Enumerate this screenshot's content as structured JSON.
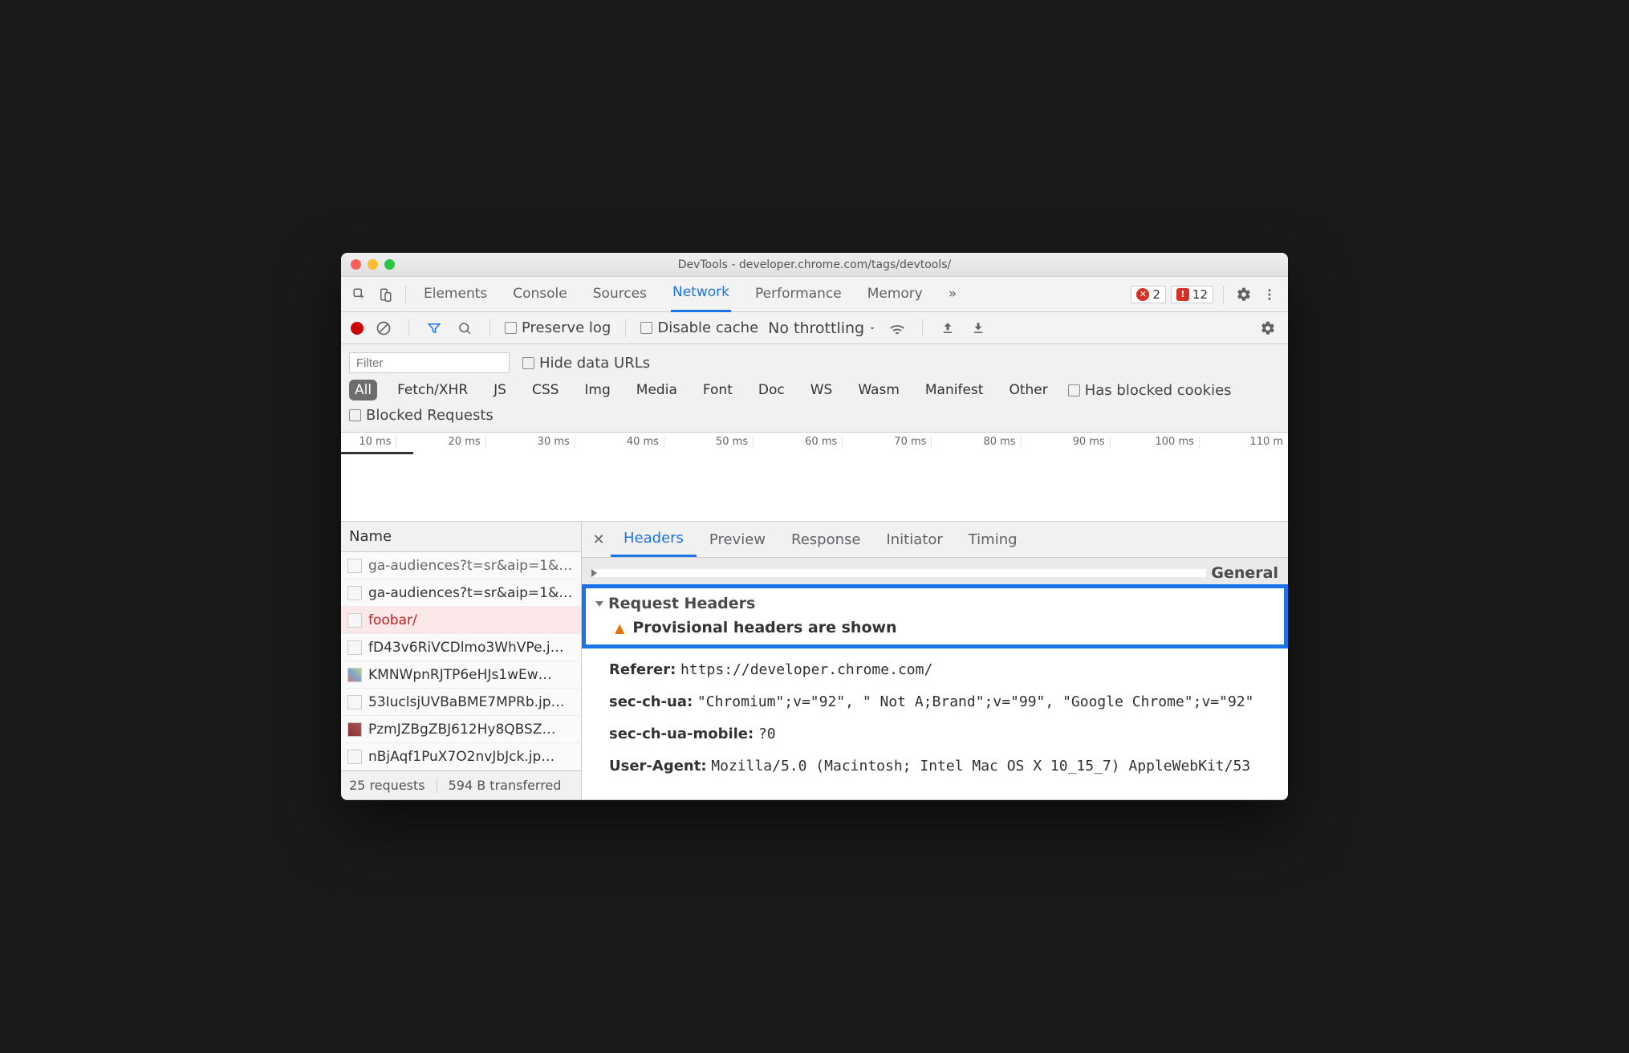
{
  "window": {
    "title": "DevTools - developer.chrome.com/tags/devtools/"
  },
  "tabs": {
    "items": [
      "Elements",
      "Console",
      "Sources",
      "Network",
      "Performance",
      "Memory"
    ],
    "active": "Network",
    "overflow": "»",
    "errors_badge": "2",
    "issues_badge": "12"
  },
  "sub1": {
    "preserve_log": "Preserve log",
    "disable_cache": "Disable cache",
    "throttling": "No throttling"
  },
  "filter": {
    "placeholder": "Filter",
    "hide_data_urls": "Hide data URLs",
    "types": [
      "All",
      "Fetch/XHR",
      "JS",
      "CSS",
      "Img",
      "Media",
      "Font",
      "Doc",
      "WS",
      "Wasm",
      "Manifest",
      "Other"
    ],
    "has_blocked_cookies": "Has blocked cookies",
    "blocked_requests": "Blocked Requests"
  },
  "timeline": {
    "ticks": [
      "10 ms",
      "20 ms",
      "30 ms",
      "40 ms",
      "50 ms",
      "60 ms",
      "70 ms",
      "80 ms",
      "90 ms",
      "100 ms",
      "110 m"
    ]
  },
  "left": {
    "header": "Name",
    "rows": [
      {
        "name": "ga-audiences?t=sr&aip=1&…"
      },
      {
        "name": "ga-audiences?t=sr&aip=1&…"
      },
      {
        "name": "foobar/",
        "err": true
      },
      {
        "name": "fD43v6RiVCDlmo3WhVPe.j…"
      },
      {
        "name": "KMNWpnRJTP6eHJs1wEw…"
      },
      {
        "name": "53IuclsjUVBaBME7MPRb.jp…"
      },
      {
        "name": "PzmJZBgZBJ612Hy8QBSZ…"
      },
      {
        "name": "nBjAqf1PuX7O2nvJbJck.jp…"
      }
    ],
    "footer": {
      "requests": "25 requests",
      "transferred": "594 B transferred"
    }
  },
  "right": {
    "tabs": [
      "Headers",
      "Preview",
      "Response",
      "Initiator",
      "Timing"
    ],
    "active": "Headers",
    "general": "General",
    "request_headers": "Request Headers",
    "provisional": "Provisional headers are shown",
    "headers": {
      "Referer": "https://developer.chrome.com/",
      "sec-ch-ua": "\"Chromium\";v=\"92\", \" Not A;Brand\";v=\"99\", \"Google Chrome\";v=\"92\"",
      "sec-ch-ua-mobile": "?0",
      "User-Agent": "Mozilla/5.0 (Macintosh; Intel Mac OS X 10_15_7) AppleWebKit/53"
    }
  }
}
